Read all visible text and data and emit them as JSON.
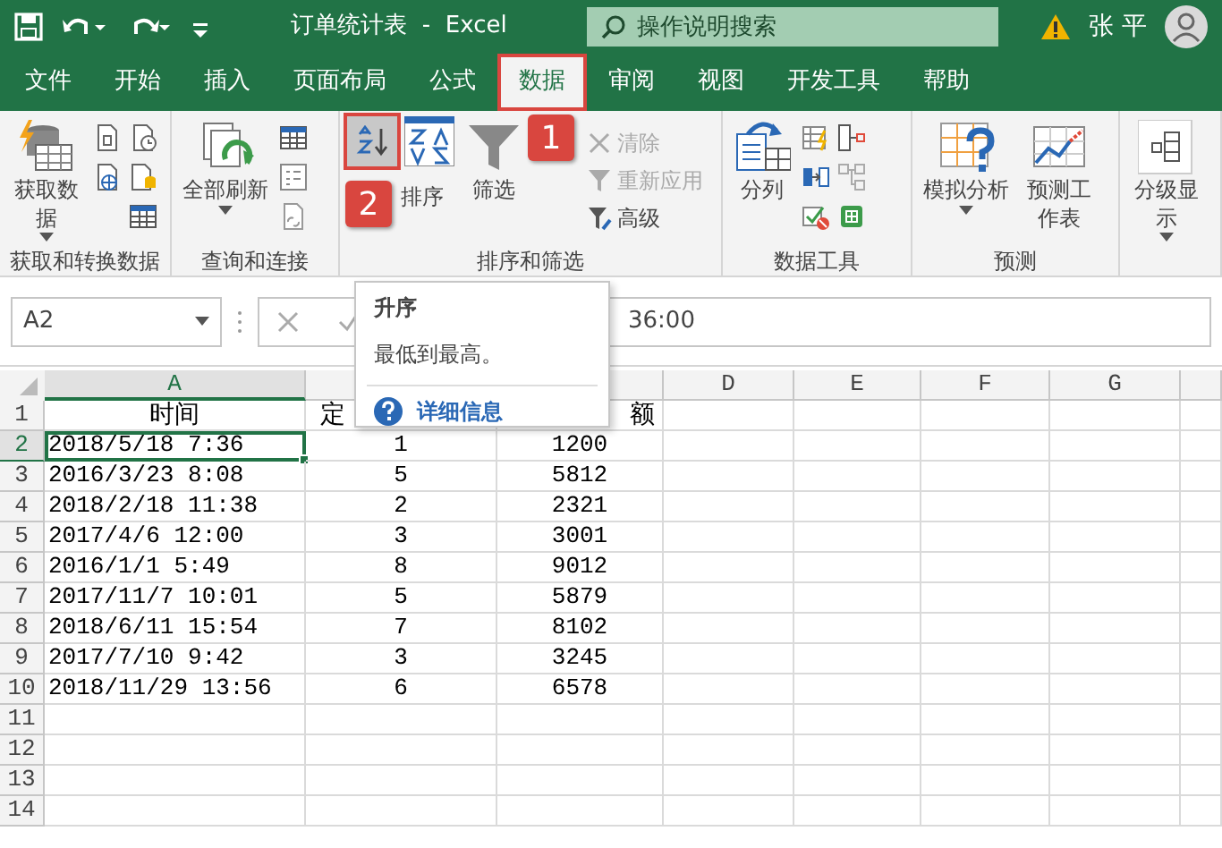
{
  "title_bar": {
    "title": "订单统计表  -  Excel",
    "search_placeholder": "操作说明搜索",
    "user": "张 平"
  },
  "tabs": [
    {
      "label": "文件",
      "selected": false,
      "highlighted": false
    },
    {
      "label": "开始",
      "selected": false,
      "highlighted": false
    },
    {
      "label": "插入",
      "selected": false,
      "highlighted": false
    },
    {
      "label": "页面布局",
      "selected": false,
      "highlighted": false
    },
    {
      "label": "公式",
      "selected": false,
      "highlighted": false
    },
    {
      "label": "数据",
      "selected": true,
      "highlighted": true
    },
    {
      "label": "审阅",
      "selected": false,
      "highlighted": false
    },
    {
      "label": "视图",
      "selected": false,
      "highlighted": false
    },
    {
      "label": "开发工具",
      "selected": false,
      "highlighted": false
    },
    {
      "label": "帮助",
      "selected": false,
      "highlighted": false
    }
  ],
  "ribbon": {
    "groups": [
      {
        "label": "获取和转换数据",
        "buttons": [
          {
            "label": "获取数据",
            "kind": "large",
            "caret": true,
            "disabled": false
          }
        ]
      },
      {
        "label": "查询和连接",
        "buttons": [
          {
            "label": "全部刷新",
            "kind": "large",
            "caret": true,
            "disabled": false
          }
        ]
      },
      {
        "label": "排序和筛选",
        "sort_buttons": [
          {
            "highlighted": true
          },
          {
            "highlighted": false
          }
        ],
        "buttons": [
          {
            "label": "排序",
            "kind": "large",
            "caret": false,
            "disabled": false
          },
          {
            "label": "筛选",
            "kind": "large",
            "caret": false,
            "disabled": false
          },
          {
            "label": "清除",
            "kind": "small",
            "caret": false,
            "disabled": true
          },
          {
            "label": "重新应用",
            "kind": "small",
            "caret": false,
            "disabled": true
          },
          {
            "label": "高级",
            "kind": "small",
            "caret": false,
            "disabled": false
          }
        ]
      },
      {
        "label": "数据工具",
        "buttons": [
          {
            "label": "分列",
            "kind": "large",
            "caret": false,
            "disabled": false
          }
        ]
      },
      {
        "label": "预测",
        "buttons": [
          {
            "label": "模拟分析",
            "kind": "large",
            "caret": true,
            "disabled": false
          },
          {
            "label": "预测工作表",
            "kind": "large",
            "caret": false,
            "disabled": false
          }
        ]
      },
      {
        "buttons": [
          {
            "label": "分级显示",
            "kind": "large",
            "caret": true,
            "disabled": false
          }
        ]
      }
    ],
    "annotations": [
      {
        "text": "1"
      },
      {
        "text": "2"
      }
    ]
  },
  "formula_bar": {
    "name_box": "A2",
    "formula": "36:00"
  },
  "tooltip": {
    "title": "升序",
    "description": "最低到最高。",
    "link": "详细信息"
  },
  "sheet": {
    "columns": [
      {
        "label": "A",
        "selected": true
      },
      {
        "selected": false
      },
      {
        "selected": false
      },
      {
        "label": "D",
        "selected": false
      },
      {
        "label": "E",
        "selected": false
      },
      {
        "label": "F",
        "selected": false
      },
      {
        "label": "G",
        "selected": false
      }
    ],
    "rows": [
      {
        "number": "1",
        "selected": false,
        "cells": [
          "时间",
          "定",
          "额"
        ]
      },
      {
        "number": "2",
        "selected": true,
        "cells": [
          "2018/5/18 7:36",
          "1",
          "1200"
        ]
      },
      {
        "number": "3",
        "selected": false,
        "cells": [
          "2016/3/23 8:08",
          "5",
          "5812"
        ]
      },
      {
        "number": "4",
        "selected": false,
        "cells": [
          "2018/2/18 11:38",
          "2",
          "2321"
        ]
      },
      {
        "number": "5",
        "selected": false,
        "cells": [
          "2017/4/6 12:00",
          "3",
          "3001"
        ]
      },
      {
        "number": "6",
        "selected": false,
        "cells": [
          "2016/1/1 5:49",
          "8",
          "9012"
        ]
      },
      {
        "number": "7",
        "selected": false,
        "cells": [
          "2017/11/7 10:01",
          "5",
          "5879"
        ]
      },
      {
        "number": "8",
        "selected": false,
        "cells": [
          "2018/6/11 15:54",
          "7",
          "8102"
        ]
      },
      {
        "number": "9",
        "selected": false,
        "cells": [
          "2017/7/10 9:42",
          "3",
          "3245"
        ]
      },
      {
        "number": "10",
        "selected": false,
        "cells": [
          "2018/11/29 13:56",
          "6",
          "6578"
        ]
      },
      {
        "number": "11",
        "selected": false,
        "cells": []
      },
      {
        "number": "12",
        "selected": false,
        "cells": []
      },
      {
        "number": "13",
        "selected": false,
        "cells": []
      },
      {
        "number": "14",
        "selected": false,
        "cells": []
      }
    ]
  }
}
